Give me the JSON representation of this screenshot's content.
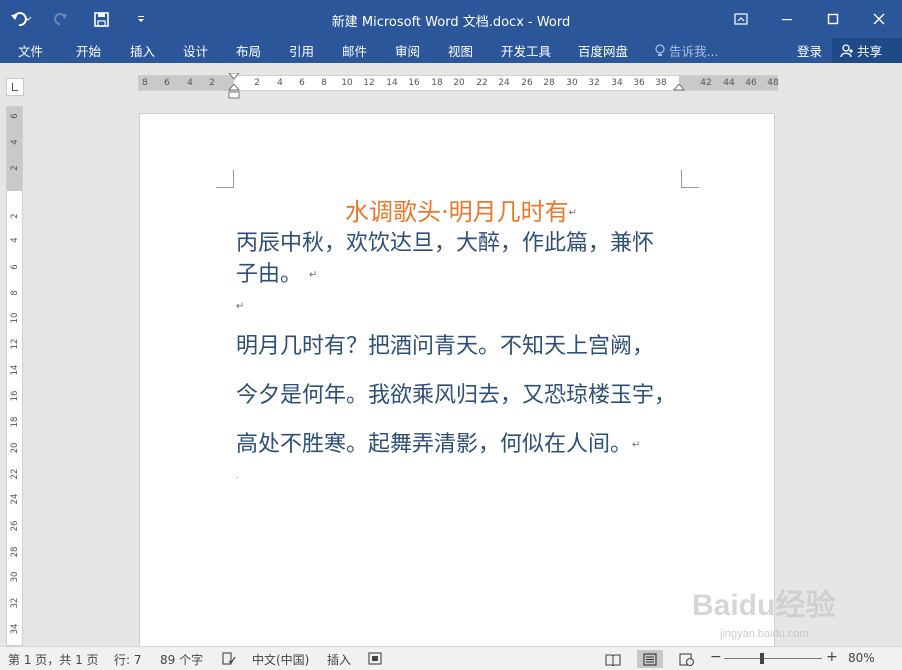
{
  "titlebar": {
    "title": "新建 Microsoft Word 文档.docx - Word",
    "icons": [
      "undo-icon",
      "redo-icon",
      "save-icon",
      "customize-qat-icon"
    ],
    "window_controls": [
      "ribbon-display-icon",
      "minimize-icon",
      "maximize-icon",
      "close-icon"
    ]
  },
  "ribbon": {
    "tabs": [
      "文件",
      "开始",
      "插入",
      "设计",
      "布局",
      "引用",
      "邮件",
      "审阅",
      "视图",
      "开发工具",
      "百度网盘"
    ],
    "tell_me": "告诉我...",
    "login": "登录",
    "share": "共享"
  },
  "ruler": {
    "h_ticks": [
      "8",
      "6",
      "4",
      "2",
      "2",
      "4",
      "6",
      "8",
      "10",
      "12",
      "14",
      "16",
      "18",
      "20",
      "22",
      "24",
      "26",
      "28",
      "30",
      "32",
      "34",
      "36",
      "38",
      "42",
      "44",
      "46",
      "48"
    ],
    "v_ticks": [
      "6",
      "4",
      "2",
      "2",
      "4",
      "6",
      "8",
      "10",
      "12",
      "14",
      "16",
      "18",
      "20",
      "22",
      "24",
      "26",
      "28",
      "30",
      "32",
      "34"
    ]
  },
  "document": {
    "title": "水调歌头·明月几时有",
    "para1_line1": "丙辰中秋，欢饮达旦，大醉，作此篇，兼怀",
    "para1_line2": "子由。",
    "line1": "明月几时有？把酒问青天。不知天上宫阙，",
    "line2": "今夕是何年。我欲乘风归去，又恐琼楼玉宇，",
    "line3": "高处不胜寒。起舞弄清影，何似在人间。",
    "return_mark": "↵"
  },
  "status": {
    "page": "第 1 页，共 1 页",
    "line": "行: 7",
    "words": "89 个字",
    "language": "中文(中国)",
    "mode": "插入",
    "zoom": "80%",
    "zoom_minus": "−",
    "zoom_plus": "+"
  },
  "watermark": {
    "brand": "Baidu经验",
    "url": "jingyan.baidu.com"
  }
}
